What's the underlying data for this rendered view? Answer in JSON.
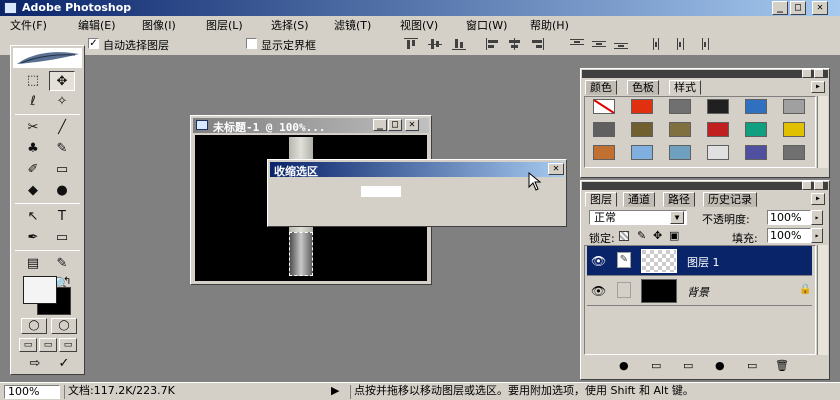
{
  "app": {
    "title": "Adobe Photoshop",
    "window_buttons": [
      "_",
      "□",
      "✕"
    ]
  },
  "menu": [
    "文件(F)",
    "编辑(E)",
    "图像(I)",
    "图层(L)",
    "选择(S)",
    "滤镜(T)",
    "视图(V)",
    "窗口(W)",
    "帮助(H)"
  ],
  "options_bar": {
    "auto_select_checked": "✓",
    "auto_select_label": "自动选择图层",
    "show_bounds_checked": "",
    "show_bounds_label": "显示定界框"
  },
  "toolbox": {
    "tools": [
      [
        "⬚",
        "✥"
      ],
      [
        "ℓ",
        "✧"
      ],
      [
        "✂",
        "╱"
      ],
      [
        "♣",
        "✎"
      ],
      [
        "✐",
        "▭"
      ],
      [
        "◆",
        "●"
      ],
      [
        "↖",
        "T"
      ],
      [
        "✒",
        "▭"
      ],
      [
        "▤",
        "✎"
      ],
      [
        "✋",
        "🔍"
      ]
    ],
    "mode_icons": [
      "◯",
      "◯"
    ],
    "screen_icons": [
      "▭",
      "▭",
      "▭"
    ],
    "jump_icons": [
      "⇨",
      "✓"
    ]
  },
  "document": {
    "title": "未标题-1 @ 100%...",
    "buttons": [
      "_",
      "□",
      "✕"
    ]
  },
  "dialog": {
    "title": "收缩选区",
    "close": "✕"
  },
  "swatches_panel": {
    "tabs": [
      "颜色",
      "色板",
      "样式"
    ],
    "active_tab": "样式",
    "menu_button": "▸",
    "style_colors": [
      [
        "#ffffff",
        "#e03010",
        "#707070",
        "#202020",
        "#3070c0",
        "#a0a0a0"
      ],
      [
        "#606060",
        "#706030",
        "#807040",
        "#c02020",
        "#10a080",
        "#e0c000"
      ],
      [
        "#c07030",
        "#80b0e0",
        "#70a0c0",
        "#e0e0e0",
        "#5050a0",
        "#707070"
      ]
    ]
  },
  "layers_panel": {
    "tabs": [
      "图层",
      "通道",
      "路径",
      "历史记录"
    ],
    "active_tab": "图层",
    "blend_mode": "正常",
    "opacity_label": "不透明度:",
    "opacity_value": "100%",
    "lock_label": "锁定:",
    "fill_label": "填充:",
    "fill_value": "100%",
    "layers": [
      {
        "name": "图层 1",
        "selected": true
      },
      {
        "name": "背景",
        "selected": false
      }
    ],
    "bottom_icons": [
      "●",
      "▭",
      "▭",
      "●",
      "▭",
      "🗑"
    ]
  },
  "status": {
    "zoom": "100%",
    "doc_info": "文档:117.2K/223.7K",
    "arrow": "▶",
    "hint": "点按并拖移以移动图层或选区。要用附加选项，使用 Shift 和 Alt 键。"
  }
}
